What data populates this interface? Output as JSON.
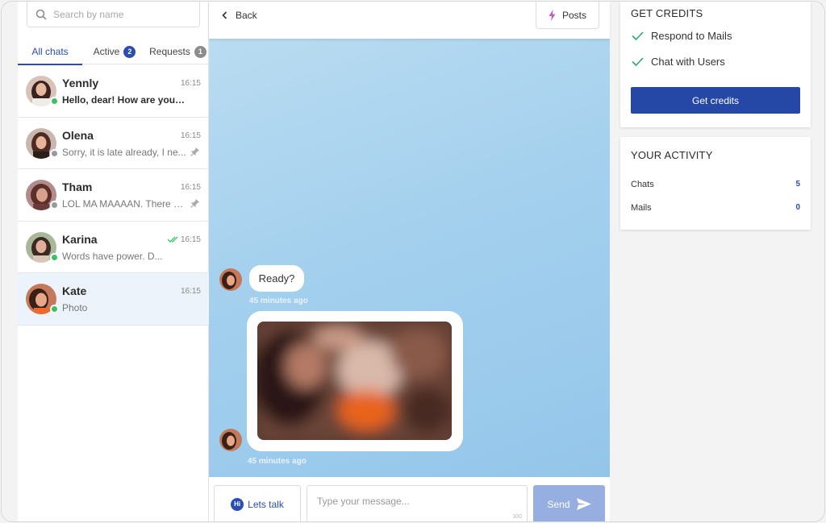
{
  "search": {
    "placeholder": "Search by name"
  },
  "tabs": [
    {
      "label": "All chats"
    },
    {
      "label": "Active",
      "badge": "2"
    },
    {
      "label": "Requests",
      "badge": "1"
    }
  ],
  "chats": [
    {
      "name": "Yennly",
      "time": "16:15",
      "preview": "Hello, dear! How are you t...",
      "status": "online"
    },
    {
      "name": "Olena",
      "time": "16:15",
      "preview": "Sorry, it is late already, I ne...",
      "status": "offline"
    },
    {
      "name": "Tham",
      "time": "16:15",
      "preview": "LOL MA MAAAAN. There w...",
      "status": "offline"
    },
    {
      "name": "Karina",
      "time": "16:15",
      "preview": "Words have power. D...",
      "status": "online"
    },
    {
      "name": "Kate",
      "time": "16:15",
      "preview": "Photo",
      "status": "online"
    }
  ],
  "header": {
    "back_label": "Back",
    "posts_label": "Posts"
  },
  "messages": [
    {
      "text": "Ready?",
      "time": "45 minutes ago"
    },
    {
      "type": "photo",
      "time": "45 minutes ago"
    }
  ],
  "composer": {
    "lets_talk_label": "Lets talk",
    "hi_label": "Hi",
    "placeholder": "Type your message...",
    "char_limit": "300",
    "send_label": "Send"
  },
  "credits": {
    "title": "GET CREDITS",
    "items": [
      "Respond to Mails",
      "Chat with Users"
    ],
    "button_label": "Get credits"
  },
  "activity": {
    "title": "YOUR ACTIVITY",
    "rows": [
      {
        "label": "Chats",
        "value": "5"
      },
      {
        "label": "Mails",
        "value": "0"
      }
    ]
  },
  "colors": {
    "accent": "#2a4eb0",
    "online": "#38c262",
    "chat_bg": "#a4d0ee",
    "send_disabled": "#96aee0"
  }
}
